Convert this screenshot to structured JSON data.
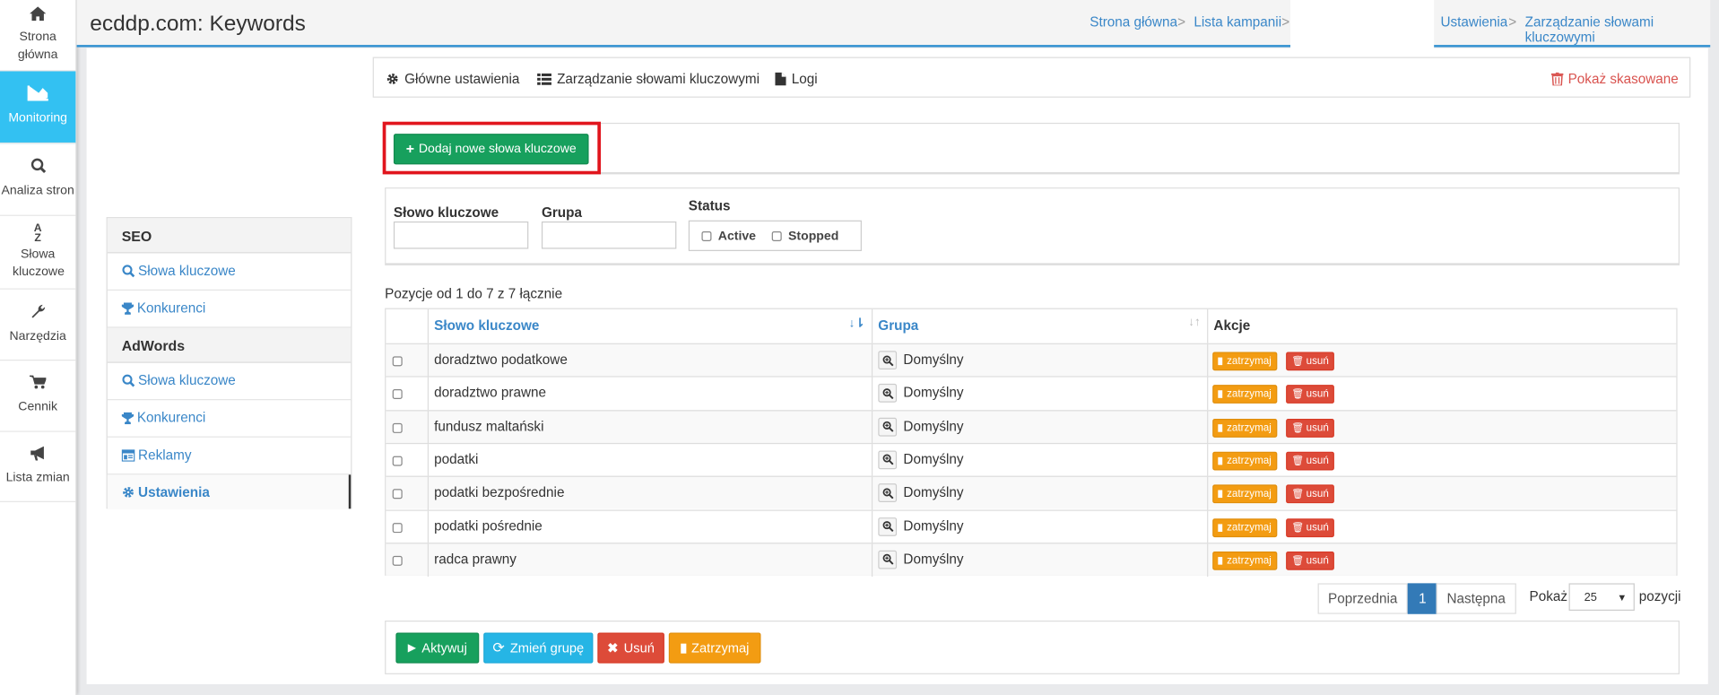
{
  "sidebar": {
    "items": [
      {
        "label": "Strona główna",
        "icon": "home-icon"
      },
      {
        "label": "Monitoring",
        "icon": "area-chart-icon",
        "active": true
      },
      {
        "label": "Analiza stron",
        "icon": "search-icon"
      },
      {
        "label": "Słowa kluczowe",
        "icon": "sort-alpha-icon"
      },
      {
        "label": "Narzędzia",
        "icon": "wrench-icon"
      },
      {
        "label": "Cennik",
        "icon": "cart-icon"
      },
      {
        "label": "Lista zmian",
        "icon": "bullhorn-icon"
      }
    ]
  },
  "header": {
    "title": "ecddp.com: Keywords",
    "breadcrumb": [
      "Strona główna",
      "Lista kampanii",
      "Ustawienia",
      "Zarządzanie słowami kluczowymi"
    ],
    "separator": ">"
  },
  "leftnav": {
    "sections": [
      {
        "title": "SEO",
        "items": [
          "Słowa kluczowe",
          "Konkurenci"
        ]
      },
      {
        "title": "AdWords",
        "items": [
          "Słowa kluczowe",
          "Konkurenci",
          "Reklamy",
          "Ustawienia"
        ]
      }
    ]
  },
  "tabs": {
    "main_settings": "Główne ustawienia",
    "keywords_mgmt": "Zarządzanie słowami kluczowymi",
    "logs": "Logi",
    "show_deleted": "Pokaż skasowane"
  },
  "add_button": "Dodaj nowe słowa kluczowe",
  "filters": {
    "keyword_label": "Słowo kluczowe",
    "group_label": "Grupa",
    "status_label": "Status",
    "status_options": [
      "Active",
      "Stopped"
    ]
  },
  "table": {
    "info": "Pozycje od 1 do 7 z 7 łącznie",
    "headers": {
      "keyword": "Słowo kluczowe",
      "group": "Grupa",
      "actions": "Akcje"
    },
    "rows": [
      {
        "keyword": "doradztwo podatkowe",
        "group": "Domyślny"
      },
      {
        "keyword": "doradztwo prawne",
        "group": "Domyślny"
      },
      {
        "keyword": "fundusz maltański",
        "group": "Domyślny"
      },
      {
        "keyword": "podatki",
        "group": "Domyślny"
      },
      {
        "keyword": "podatki bezpośrednie",
        "group": "Domyślny"
      },
      {
        "keyword": "podatki pośrednie",
        "group": "Domyślny"
      },
      {
        "keyword": "radca prawny",
        "group": "Domyślny"
      }
    ],
    "action_stop": "zatrzymaj",
    "action_delete": "usuń"
  },
  "pagination": {
    "prev": "Poprzednia",
    "page": "1",
    "next": "Następna",
    "show_label": "Pokaż",
    "per_page": "25",
    "positions_label": "pozycji"
  },
  "bulk": {
    "activate": "Aktywuj",
    "change_group": "Zmień grupę",
    "delete": "Usuń",
    "stop": "Zatrzymaj"
  },
  "colors": {
    "accent": "#33c1f2",
    "link": "#3a87c8",
    "green": "#17a05d",
    "orange": "#f39c12",
    "red": "#dd4b39",
    "highlight": "#e1151d"
  }
}
